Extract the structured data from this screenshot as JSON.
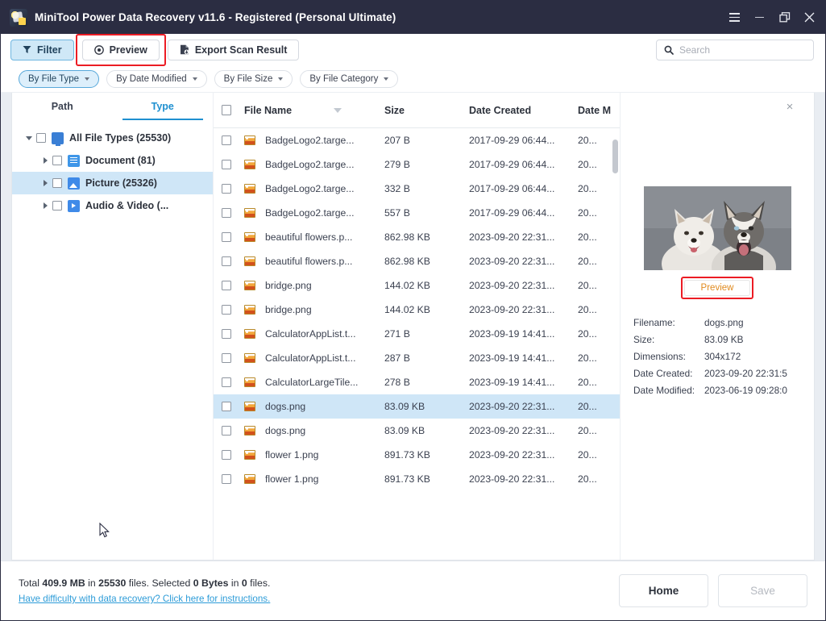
{
  "window": {
    "title": "MiniTool Power Data Recovery v11.6 - Registered (Personal Ultimate)",
    "app_icon": "minitool-app-icon",
    "controls": {
      "menu": "menu-icon",
      "minimize": "minimize-icon",
      "restore": "restore-icon",
      "close": "close-icon"
    }
  },
  "toolbar": {
    "filter_label": "Filter",
    "preview_label": "Preview",
    "export_label": "Export Scan Result",
    "highlight_color": "#ec1c24",
    "accent_color": "#1f90d0"
  },
  "search": {
    "placeholder": "Search",
    "value": ""
  },
  "filters": [
    {
      "label": "By File Type",
      "active": true
    },
    {
      "label": "By Date Modified",
      "active": false
    },
    {
      "label": "By File Size",
      "active": false
    },
    {
      "label": "By File Category",
      "active": false
    }
  ],
  "left_panel": {
    "tabs": [
      {
        "label": "Path",
        "active": false
      },
      {
        "label": "Type",
        "active": true
      }
    ],
    "tree": [
      {
        "label": "All File Types (25530)",
        "icon": "monitor-icon",
        "depth": 0,
        "expanded": true,
        "checked": false,
        "selected": false
      },
      {
        "label": "Document (81)",
        "icon": "document-icon",
        "depth": 1,
        "expanded": false,
        "checked": false,
        "selected": false
      },
      {
        "label": "Picture (25326)",
        "icon": "picture-icon",
        "depth": 1,
        "expanded": false,
        "checked": false,
        "selected": true
      },
      {
        "label": "Audio & Video (...",
        "icon": "audio-video-icon",
        "depth": 1,
        "expanded": false,
        "checked": false,
        "selected": false
      }
    ]
  },
  "file_list": {
    "columns": [
      "File Name",
      "Size",
      "Date Created",
      "Date M"
    ],
    "sort_column": "File Name",
    "rows": [
      {
        "name": "BadgeLogo2.targe...",
        "size": "207 B",
        "created": "2017-09-29 06:44...",
        "modified": "20...",
        "selected": false
      },
      {
        "name": "BadgeLogo2.targe...",
        "size": "279 B",
        "created": "2017-09-29 06:44...",
        "modified": "20...",
        "selected": false
      },
      {
        "name": "BadgeLogo2.targe...",
        "size": "332 B",
        "created": "2017-09-29 06:44...",
        "modified": "20...",
        "selected": false
      },
      {
        "name": "BadgeLogo2.targe...",
        "size": "557 B",
        "created": "2017-09-29 06:44...",
        "modified": "20...",
        "selected": false
      },
      {
        "name": "beautiful flowers.p...",
        "size": "862.98 KB",
        "created": "2023-09-20 22:31...",
        "modified": "20...",
        "selected": false
      },
      {
        "name": "beautiful flowers.p...",
        "size": "862.98 KB",
        "created": "2023-09-20 22:31...",
        "modified": "20...",
        "selected": false
      },
      {
        "name": "bridge.png",
        "size": "144.02 KB",
        "created": "2023-09-20 22:31...",
        "modified": "20...",
        "selected": false
      },
      {
        "name": "bridge.png",
        "size": "144.02 KB",
        "created": "2023-09-20 22:31...",
        "modified": "20...",
        "selected": false
      },
      {
        "name": "CalculatorAppList.t...",
        "size": "271 B",
        "created": "2023-09-19 14:41...",
        "modified": "20...",
        "selected": false
      },
      {
        "name": "CalculatorAppList.t...",
        "size": "287 B",
        "created": "2023-09-19 14:41...",
        "modified": "20...",
        "selected": false
      },
      {
        "name": "CalculatorLargeTile...",
        "size": "278 B",
        "created": "2023-09-19 14:41...",
        "modified": "20...",
        "selected": false
      },
      {
        "name": "dogs.png",
        "size": "83.09 KB",
        "created": "2023-09-20 22:31...",
        "modified": "20...",
        "selected": true
      },
      {
        "name": "dogs.png",
        "size": "83.09 KB",
        "created": "2023-09-20 22:31...",
        "modified": "20...",
        "selected": false
      },
      {
        "name": "flower 1.png",
        "size": "891.73 KB",
        "created": "2023-09-20 22:31...",
        "modified": "20...",
        "selected": false
      },
      {
        "name": "flower 1.png",
        "size": "891.73 KB",
        "created": "2023-09-20 22:31...",
        "modified": "20...",
        "selected": false
      }
    ]
  },
  "preview_panel": {
    "close_glyph": "×",
    "image_alt": "two-husky-dogs-thumbnail",
    "preview_button": "Preview",
    "preview_button_color": "#e08a1e",
    "details": [
      {
        "key": "Filename:",
        "value": "dogs.png"
      },
      {
        "key": "Size:",
        "value": "83.09 KB"
      },
      {
        "key": "Dimensions:",
        "value": "304x172"
      },
      {
        "key": "Date Created:",
        "value": "2023-09-20 22:31:5"
      },
      {
        "key": "Date Modified:",
        "value": "2023-06-19 09:28:0"
      }
    ]
  },
  "footer": {
    "status_prefix": "Total ",
    "total_size": "409.9 MB",
    "status_mid1": " in ",
    "total_files": "25530",
    "status_mid2": " files.  Selected ",
    "selected_size": "0 Bytes",
    "status_mid3": " in ",
    "selected_files": "0",
    "status_suffix": " files.",
    "help_link": "Have difficulty with data recovery? Click here for instructions.",
    "home_label": "Home",
    "save_label": "Save"
  }
}
